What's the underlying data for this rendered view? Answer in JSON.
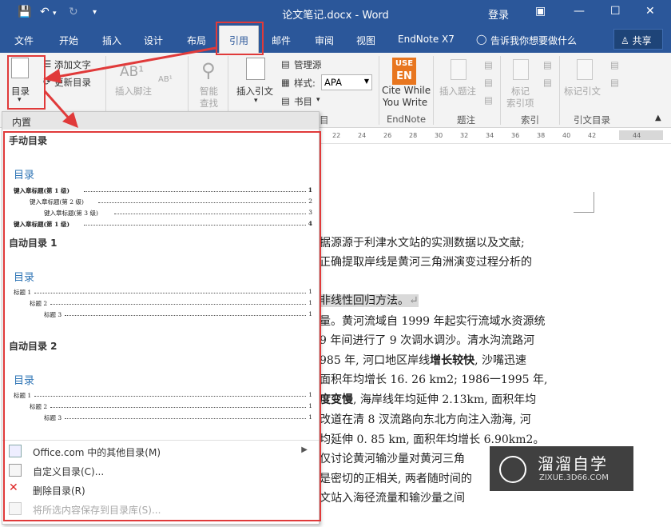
{
  "titlebar": {
    "title": "论文笔记.docx  -  Word",
    "login": "登录",
    "icons": [
      "save-icon",
      "undo-icon",
      "redo-icon",
      "customize-icon"
    ]
  },
  "tabs": [
    "文件",
    "开始",
    "插入",
    "设计",
    "布局",
    "引用",
    "邮件",
    "审阅",
    "视图",
    "EndNote X7"
  ],
  "active_tab": "引用",
  "tell_me": "告诉我你想要做什么",
  "share": "共享",
  "ribbon": {
    "toc_button": "目录",
    "add_text": "添加文字",
    "update_toc": "更新目录",
    "footnote": "插入脚注",
    "smart_lookup_line1": "智能",
    "smart_lookup_line2": "查找",
    "insert_citation": "插入引文",
    "manage_sources": "管理源",
    "style_label": "样式:",
    "style_value": "APA",
    "bibliography": "书目",
    "group_citations_tail": "目",
    "endnote_logo_top": "USE",
    "endnote_logo_bottom": "EN",
    "cite_while_1": "Cite While",
    "cite_while_2": "You Write",
    "group_endnote": "EndNote",
    "insert_caption": "插入题注",
    "group_captions": "题注",
    "mark_entry_1": "标记",
    "mark_entry_2": "索引项",
    "group_index": "索引",
    "mark_citation": "标记引文",
    "group_toa": "引文目录"
  },
  "ruler_ticks": [
    "22",
    "24",
    "26",
    "28",
    "30",
    "32",
    "34",
    "36",
    "38",
    "40",
    "42",
    "44"
  ],
  "dropdown": {
    "header": "内置",
    "manual_title": "手动目录",
    "manual_toc_head": "目录",
    "manual_entries": [
      {
        "label": "键入章标题(第 1 级)",
        "page": "1"
      },
      {
        "label": "键入章标题(第 2 级)",
        "page": "2"
      },
      {
        "label": "键入章标题(第 3 级)",
        "page": "3"
      },
      {
        "label": "键入章标题(第 1 级)",
        "page": "4"
      }
    ],
    "auto1_title": "自动目录 1",
    "auto1_toc_head": "目录",
    "auto1_entries": [
      {
        "label": "标题 1",
        "page": "1"
      },
      {
        "label": "标题 2",
        "page": "1"
      },
      {
        "label": "标题 3",
        "page": "1"
      }
    ],
    "auto2_title": "自动目录 2",
    "auto2_toc_head": "目录",
    "auto2_entries": [
      {
        "label": "标题 1",
        "page": "1"
      },
      {
        "label": "标题 2",
        "page": "1"
      },
      {
        "label": "标题 3",
        "page": "1"
      }
    ],
    "menu": {
      "more_toc": "Office.com 中的其他目录(M)",
      "custom_toc": "自定义目录(C)...",
      "remove_toc": "删除目录(R)",
      "save_selection": "将所选内容保存到目录库(S)..."
    }
  },
  "document_lines": [
    "据源源于利津水文站的实测数据以及文献;",
    "正确提取岸线是黄河三角洲演变过程分析的",
    "非线性回归方法。",
    "量。黄河流域自 1999 年起实行流域水资源统",
    "9 年间进行了 9 次调水调沙。清水沟流路河",
    "985 年, 河口地区岸线",
    "增长较快",
    ", 沙嘴迅速",
    "面积年均增长 16. 26 km2; 1986一1995 年,",
    "度变慢",
    ", 海岸线年均延伸 2.13km, 面积年均",
    "改道在清 8 汊流路向东北方向注入渤海, 河",
    "均延伸 0. 85 km, 面积年均增长 6.90km2。",
    "仅讨论黄河输沙量对黄河三角",
    "是密切的正相关, 两者随时间的",
    "文站入海径流量和输沙量之间"
  ],
  "watermark": {
    "title": "溜溜自学",
    "url": "ZIXUE.3D66.COM"
  },
  "colors": {
    "word_blue": "#2b579a",
    "annotation_red": "#e03a3a",
    "toc_heading_blue": "#2e74b5"
  }
}
